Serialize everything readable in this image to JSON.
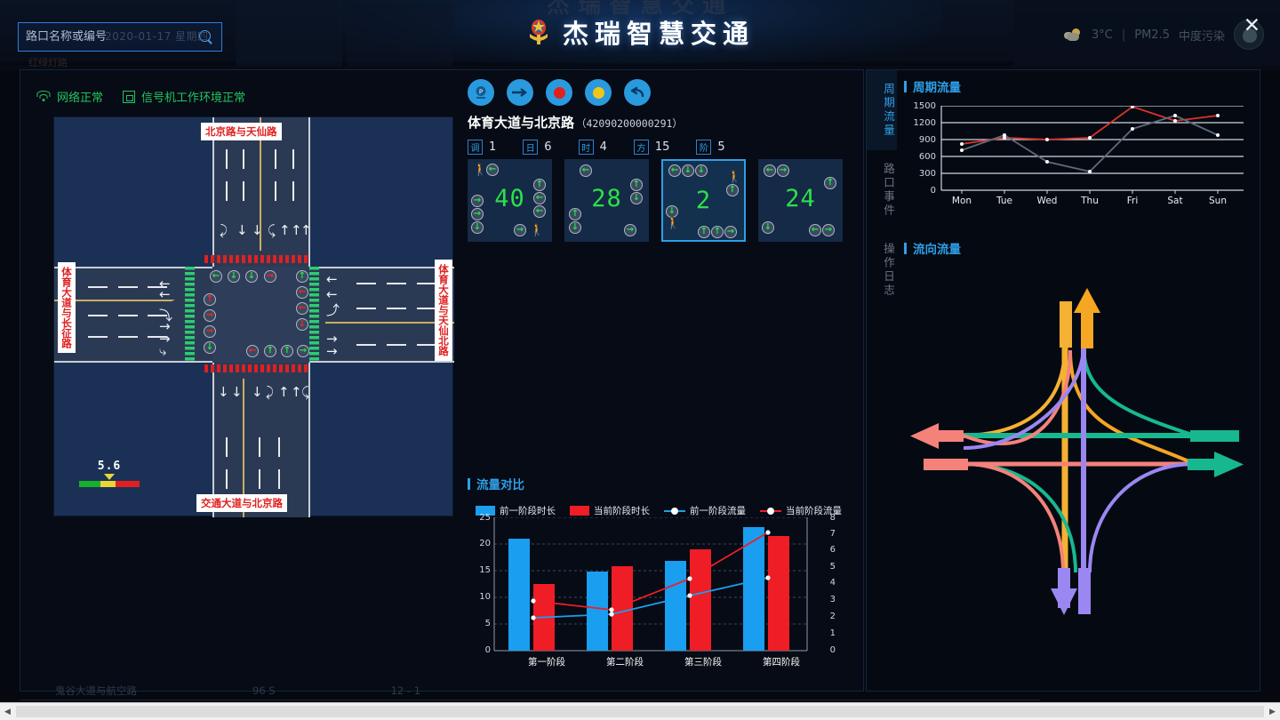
{
  "header": {
    "brand_title": "杰瑞智慧交通",
    "brand_ghost": "杰瑞智慧交通",
    "search_placeholder": "路口名称或编号",
    "search_value": "",
    "ghost_date": "2020-01-17 星期四",
    "ghost_sub": "红绿灯路",
    "weather_temp": "3°C",
    "weather_sep": "|",
    "pm_label": "PM2.5",
    "pm_value": "中度污染",
    "close_label": "✕"
  },
  "status": {
    "network": "网络正常",
    "device": "信号机工作环境正常"
  },
  "intersection_map": {
    "label_top": "北京路与天仙路",
    "label_bottom": "交通大道与北京路",
    "label_left": "体育大道与长征路",
    "label_right": "体育大道与天仙北路",
    "gauge_value": "5.6",
    "signals_top": [
      "←",
      "↓",
      "↓",
      "→"
    ],
    "signals_top_colors": [
      "g",
      "g",
      "g",
      "r"
    ],
    "signals_bottom": [
      "←",
      "↑",
      "↑",
      "→"
    ],
    "signals_bottom_colors": [
      "r",
      "g",
      "g",
      "g"
    ],
    "signals_left": [
      "↑",
      "→",
      "→",
      "↓"
    ],
    "signals_left_colors": [
      "r",
      "r",
      "r",
      "g"
    ],
    "signals_right": [
      "↑",
      "←",
      "←",
      "↓"
    ],
    "signals_right_colors": [
      "g",
      "r",
      "r",
      "r"
    ]
  },
  "signal_control": {
    "toolbar": [
      {
        "name": "location-icon",
        "glyph": "P"
      },
      {
        "name": "arrow-right-icon",
        "glyph": "→"
      },
      {
        "name": "red-light-icon",
        "glyph": ""
      },
      {
        "name": "yellow-light-icon",
        "glyph": ""
      },
      {
        "name": "undo-icon",
        "glyph": "↩"
      }
    ],
    "intersection_name": "体育大道与北京路",
    "intersection_code": "（42090200000291）",
    "meta": [
      {
        "tag": "调",
        "value": "1"
      },
      {
        "tag": "日",
        "value": "6"
      },
      {
        "tag": "时",
        "value": "4"
      },
      {
        "tag": "方",
        "value": "15"
      },
      {
        "tag": "阶",
        "value": "5"
      }
    ],
    "phases": [
      {
        "countdown": "40",
        "selected": false
      },
      {
        "countdown": "28",
        "selected": false
      },
      {
        "countdown": "2",
        "selected": true
      },
      {
        "countdown": "24",
        "selected": false
      }
    ]
  },
  "right_panel": {
    "tabs": [
      {
        "label": "周期流量",
        "active": true
      },
      {
        "label": "路口事件",
        "active": false
      },
      {
        "label": "操作日志",
        "active": false
      }
    ],
    "section_cycle_flow": "周期流量",
    "section_turn_flow": "流向流量"
  },
  "compare_section": {
    "title": "流量对比"
  },
  "bottom_ghost": {
    "name": "鬼谷大道与航空路",
    "duration": "96 S",
    "extra": "12  -   1"
  },
  "chart_data": [
    {
      "id": "cycle-flow",
      "type": "line",
      "title": "周期流量",
      "x": [
        "Mon",
        "Tue",
        "Wed",
        "Thu",
        "Fri",
        "Sat",
        "Sun"
      ],
      "ylim": [
        0,
        1500
      ],
      "yticks": [
        0,
        300,
        600,
        900,
        1200,
        1500
      ],
      "grid": true,
      "series": [
        {
          "name": "red-series",
          "color": "#e0322b",
          "values": [
            820,
            930,
            900,
            935,
            1490,
            1230,
            1320
          ]
        },
        {
          "name": "gray-series",
          "color": "#5d6b7d",
          "values": [
            710,
            985,
            505,
            325,
            1090,
            1320,
            985
          ]
        }
      ]
    },
    {
      "id": "flow-compare",
      "type": "bar",
      "title": "流量对比",
      "categories": [
        "第一阶段",
        "第二阶段",
        "第三阶段",
        "第四阶段"
      ],
      "ylim": [
        0,
        25
      ],
      "yticks": [
        0,
        5,
        10,
        15,
        20,
        25
      ],
      "y2lim": [
        0,
        8
      ],
      "y2ticks": [
        0,
        1,
        2,
        3,
        4,
        5,
        6,
        7,
        8
      ],
      "grid": true,
      "legend_position": "top",
      "series": [
        {
          "name": "前一阶段时长",
          "type": "bar",
          "color": "#1a9ef0",
          "values": [
            21,
            14.9,
            16.9,
            23.2
          ]
        },
        {
          "name": "当前阶段时长",
          "type": "bar",
          "color": "#ee1d26",
          "values": [
            12.5,
            15.8,
            19,
            21.4
          ]
        },
        {
          "name": "前一阶段流量",
          "type": "line",
          "color": "#1a9ef0",
          "values": [
            1.95,
            2.2,
            3.3,
            4.4
          ]
        },
        {
          "name": "当前阶段流量",
          "type": "line",
          "color": "#ee1d26",
          "values": [
            3.0,
            2.45,
            4.3,
            7.1
          ]
        }
      ]
    },
    {
      "id": "turn-flow",
      "type": "diagram",
      "title": "流向流量",
      "directions": [
        {
          "name": "north-out",
          "color": "#f5b133"
        },
        {
          "name": "north-out-2",
          "color": "#f5a623"
        },
        {
          "name": "west-out",
          "color": "#f4827b"
        },
        {
          "name": "west-in",
          "color": "#f4827b"
        },
        {
          "name": "east-out",
          "color": "#17b890"
        },
        {
          "name": "east-in",
          "color": "#17b890"
        },
        {
          "name": "south-out",
          "color": "#9b87f2"
        },
        {
          "name": "south-in",
          "color": "#9b87f2"
        }
      ]
    }
  ]
}
